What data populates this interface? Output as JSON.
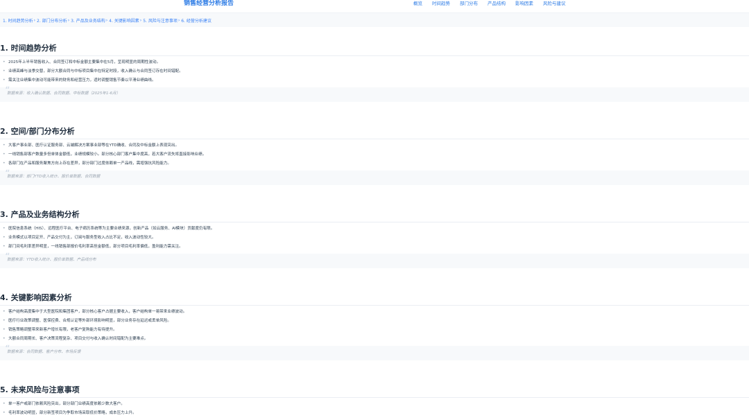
{
  "header": {
    "title": "销售经营分析报告",
    "nav": [
      "概览",
      "时间趋势",
      "部门分布",
      "产品结构",
      "影响因素",
      "风险与建议"
    ]
  },
  "toc": [
    "1. 时间趋势分析",
    "2. 部门分布分析",
    "3. 产品及业务结构",
    "4. 关键影响因素",
    "5. 风险与注意事项",
    "6. 经营分析建议"
  ],
  "toc_separator": "›",
  "quote_mark": "“",
  "sections": [
    {
      "title": "1. 时间趋势分析",
      "bullets": [
        "2025年上半年销售收入、合同签订和中标金额主要集中在5月，呈现明显的周期性波动。",
        "业绩高峰与淡季交替，部分大额合同与中标项目集中在特定时段，收入确认与合同签订存在时间错配。",
        "需关注业绩集中波动可能带来的财务和经营压力，适时调整销售节奏以平滑业绩曲线。"
      ],
      "source": "数据来源：收入确认数据、合同数据、中标数据（2025年1-6月）"
    },
    {
      "title": "2. 空间/部门分布分析",
      "bullets": [
        "大客户事业部、医疗认证服务部、云端解决方案事业部等在YTD确收、合同及中标金额上表现突出。",
        "一线销售部客户数量多但单体金额低，业绩规模较小。部分核心部门客户集中度高，若大客户流失将直接影响业绩。",
        "各部门在产品和服务聚焦方向上存在差异，部分部门过度依赖单一产品线，需增强抗风险能力。"
      ],
      "source": "数据来源：部门YTD收入统计、报价单数据、合同数据"
    },
    {
      "title": "3. 产品及业务结构分析",
      "bullets": [
        "医院信息系统（HIS）、远程医疗平台、电子病历系统等为主要业绩来源，创新产品（如云服务、AI模块）贡献度仍有限。",
        "业务模式以项目定开、产品交付为主，订阅与服务型收入占比不足，收入波动性较大。",
        "部门间毛利率差异明显，一线销售部报价毛利率高但金额低，部分项目毛利率偏低，盈利能力需关注。"
      ],
      "source": "数据来源：YTD收入统计、报价单数据、产品线分布"
    },
    {
      "title": "4. 关键影响因素分析",
      "bullets": [
        "客户结构高度集中于大型医院和集团客户，部分核心客户占据主要收入，客户结构单一易带来业绩波动。",
        "医疗行业政策调整、医保控费、合规认证等外部环境影响明显，部分业务存在延迟或丢单风险。",
        "销售策略调整带来新客户增长有限，老客户复购能力有待提升。",
        "大额合同周期长、客户决策流程复杂、项目交付与收入确认时间错配为主要难点。"
      ],
      "source": "数据来源：合同数据、客户分布、市场反馈"
    },
    {
      "title": "5. 未来风险与注意事项",
      "bullets": [
        "单一客户或部门依赖风险突出，部分部门业绩高度依赖少数大客户。",
        "毛利率波动明显，部分新签项目为争取市场采取低价策略，成本压力上升。"
      ],
      "source": ""
    }
  ]
}
